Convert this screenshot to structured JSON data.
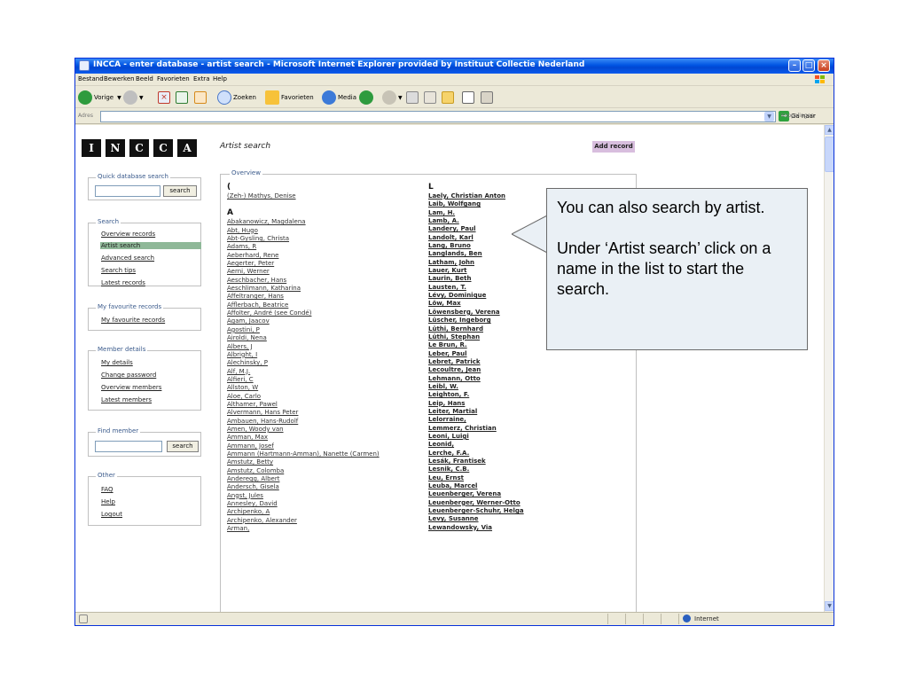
{
  "window": {
    "title": "INCCA - enter database - artist search - Microsoft Internet Explorer provided by Instituut Collectie Nederland"
  },
  "menu": [
    "Bestand",
    "Bewerken",
    "Beeld",
    "Favorieten",
    "Extra",
    "Help"
  ],
  "toolbar": {
    "back": "Vorige",
    "search": "Zoeken",
    "favorites": "Favorieten",
    "media": "Media"
  },
  "address": {
    "label": "Adres",
    "value": "",
    "go": "Ga naar",
    "links": "Koppelingen"
  },
  "page": {
    "logo_letters": [
      "I",
      "N",
      "C",
      "C",
      "A"
    ],
    "title": "Artist search",
    "add_record": "Add record"
  },
  "sidebar": {
    "quick_search": {
      "legend": "Quick database search",
      "button": "search",
      "value": ""
    },
    "search": {
      "legend": "Search",
      "items": [
        "Overview records",
        "Artist search",
        "Advanced search",
        "Search tips",
        "Latest records"
      ],
      "active": "Artist search"
    },
    "favourites": {
      "legend": "My favourite records",
      "items": [
        "My favourite records"
      ]
    },
    "member": {
      "legend": "Member details",
      "items": [
        "My details",
        "Change password",
        "Overview members",
        "Latest members"
      ]
    },
    "find_member": {
      "legend": "Find member",
      "button": "search",
      "value": ""
    },
    "other": {
      "legend": "Other",
      "items": [
        "FAQ",
        "Help",
        "Logout"
      ]
    }
  },
  "overview": {
    "legend": "Overview",
    "col1": {
      "group1": {
        "letter": "(",
        "items": [
          "(Zeh-) Mathys, Denise"
        ]
      },
      "group2": {
        "letter": "A",
        "items": [
          "Abakanowicz, Magdalena",
          "Abt, Hugo",
          "Abt-Gysling, Christa",
          "Adams, R",
          "Aeberhard, Rene",
          "Aegerter, Peter",
          "Aerni, Werner",
          "Aeschbacher, Hans",
          "Aeschlimann, Katharina",
          "Affeltranger, Hans",
          "Afflerbach, Beatrice",
          "Affolter, André (see Condé)",
          "Agam, Jaacov",
          "Agostini, P",
          "Airoldi, Nena",
          "Albers, J",
          "Albright, I",
          "Alechinsky, P",
          "Alf, M.J.",
          "Alfieri, C",
          "Allston, W",
          "Aloe, Carlo",
          "Althamer, Pawel",
          "Alvermann, Hans Peter",
          "Ambauen, Hans-Rudolf",
          "Amen, Woody van",
          "Amman, Max",
          "Ammann, Josef",
          "Ammann (Hartmann-Amman), Nanette (Carmen)",
          "Amstutz, Betty",
          "Amstutz, Colomba",
          "Anderegg, Albert",
          "Andersch, Gisela",
          "Angst, Jules",
          "Annesley, David",
          "Archipenko, A",
          "Archipenko, Alexander",
          "Arman,"
        ]
      }
    },
    "col2": {
      "letter": "L",
      "items": [
        "Laely, Christian Anton",
        "Laib, Wolfgang",
        "Lam, H.",
        "Lamb, A.",
        "Landery, Paul",
        "Landolt, Karl",
        "Lang, Bruno",
        "Langlands, Ben",
        "Latham, John",
        "Lauer, Kurt",
        "Laurin, Beth",
        "Lausten, T.",
        "Lévy, Dominique",
        "Löw, Max",
        "Löwensberg, Verena",
        "Lüscher, Ingeborg",
        "Lüthi, Bernhard",
        "Lüthi, Stephan",
        "Le Brun, R.",
        "Leber, Paul",
        "Lebret, Patrick",
        "Lecoultre, Jean",
        "Lehmann, Otto",
        "Leibl, W.",
        "Leighton, F.",
        "Leip, Hans",
        "Leiter, Martial",
        "Lelorraine,",
        "Lemmerz, Christian",
        "Leoni, Luigi",
        "Leonid,",
        "Lerche, F.A.",
        "Lesák, Frantisek",
        "Lesnik, C.B.",
        "Leu, Ernst",
        "Leuba, Marcel",
        "Leuenberger, Verena",
        "Leuenberger, Werner-Otto",
        "Leuenberger-Schuhr, Helga",
        "Levy, Susanne",
        "Lewandowsky, Via"
      ]
    }
  },
  "status": {
    "zone": "Internet"
  },
  "callout": {
    "text": "You can also search by artist.\n\nUnder ‘Artist search’ click on a name in the list to start the search."
  },
  "colors": {
    "titlebar": "#0054e3",
    "active_item": "#8fb898",
    "add_record_bg": "#d8bede",
    "callout_bg": "#eaf0f5"
  }
}
